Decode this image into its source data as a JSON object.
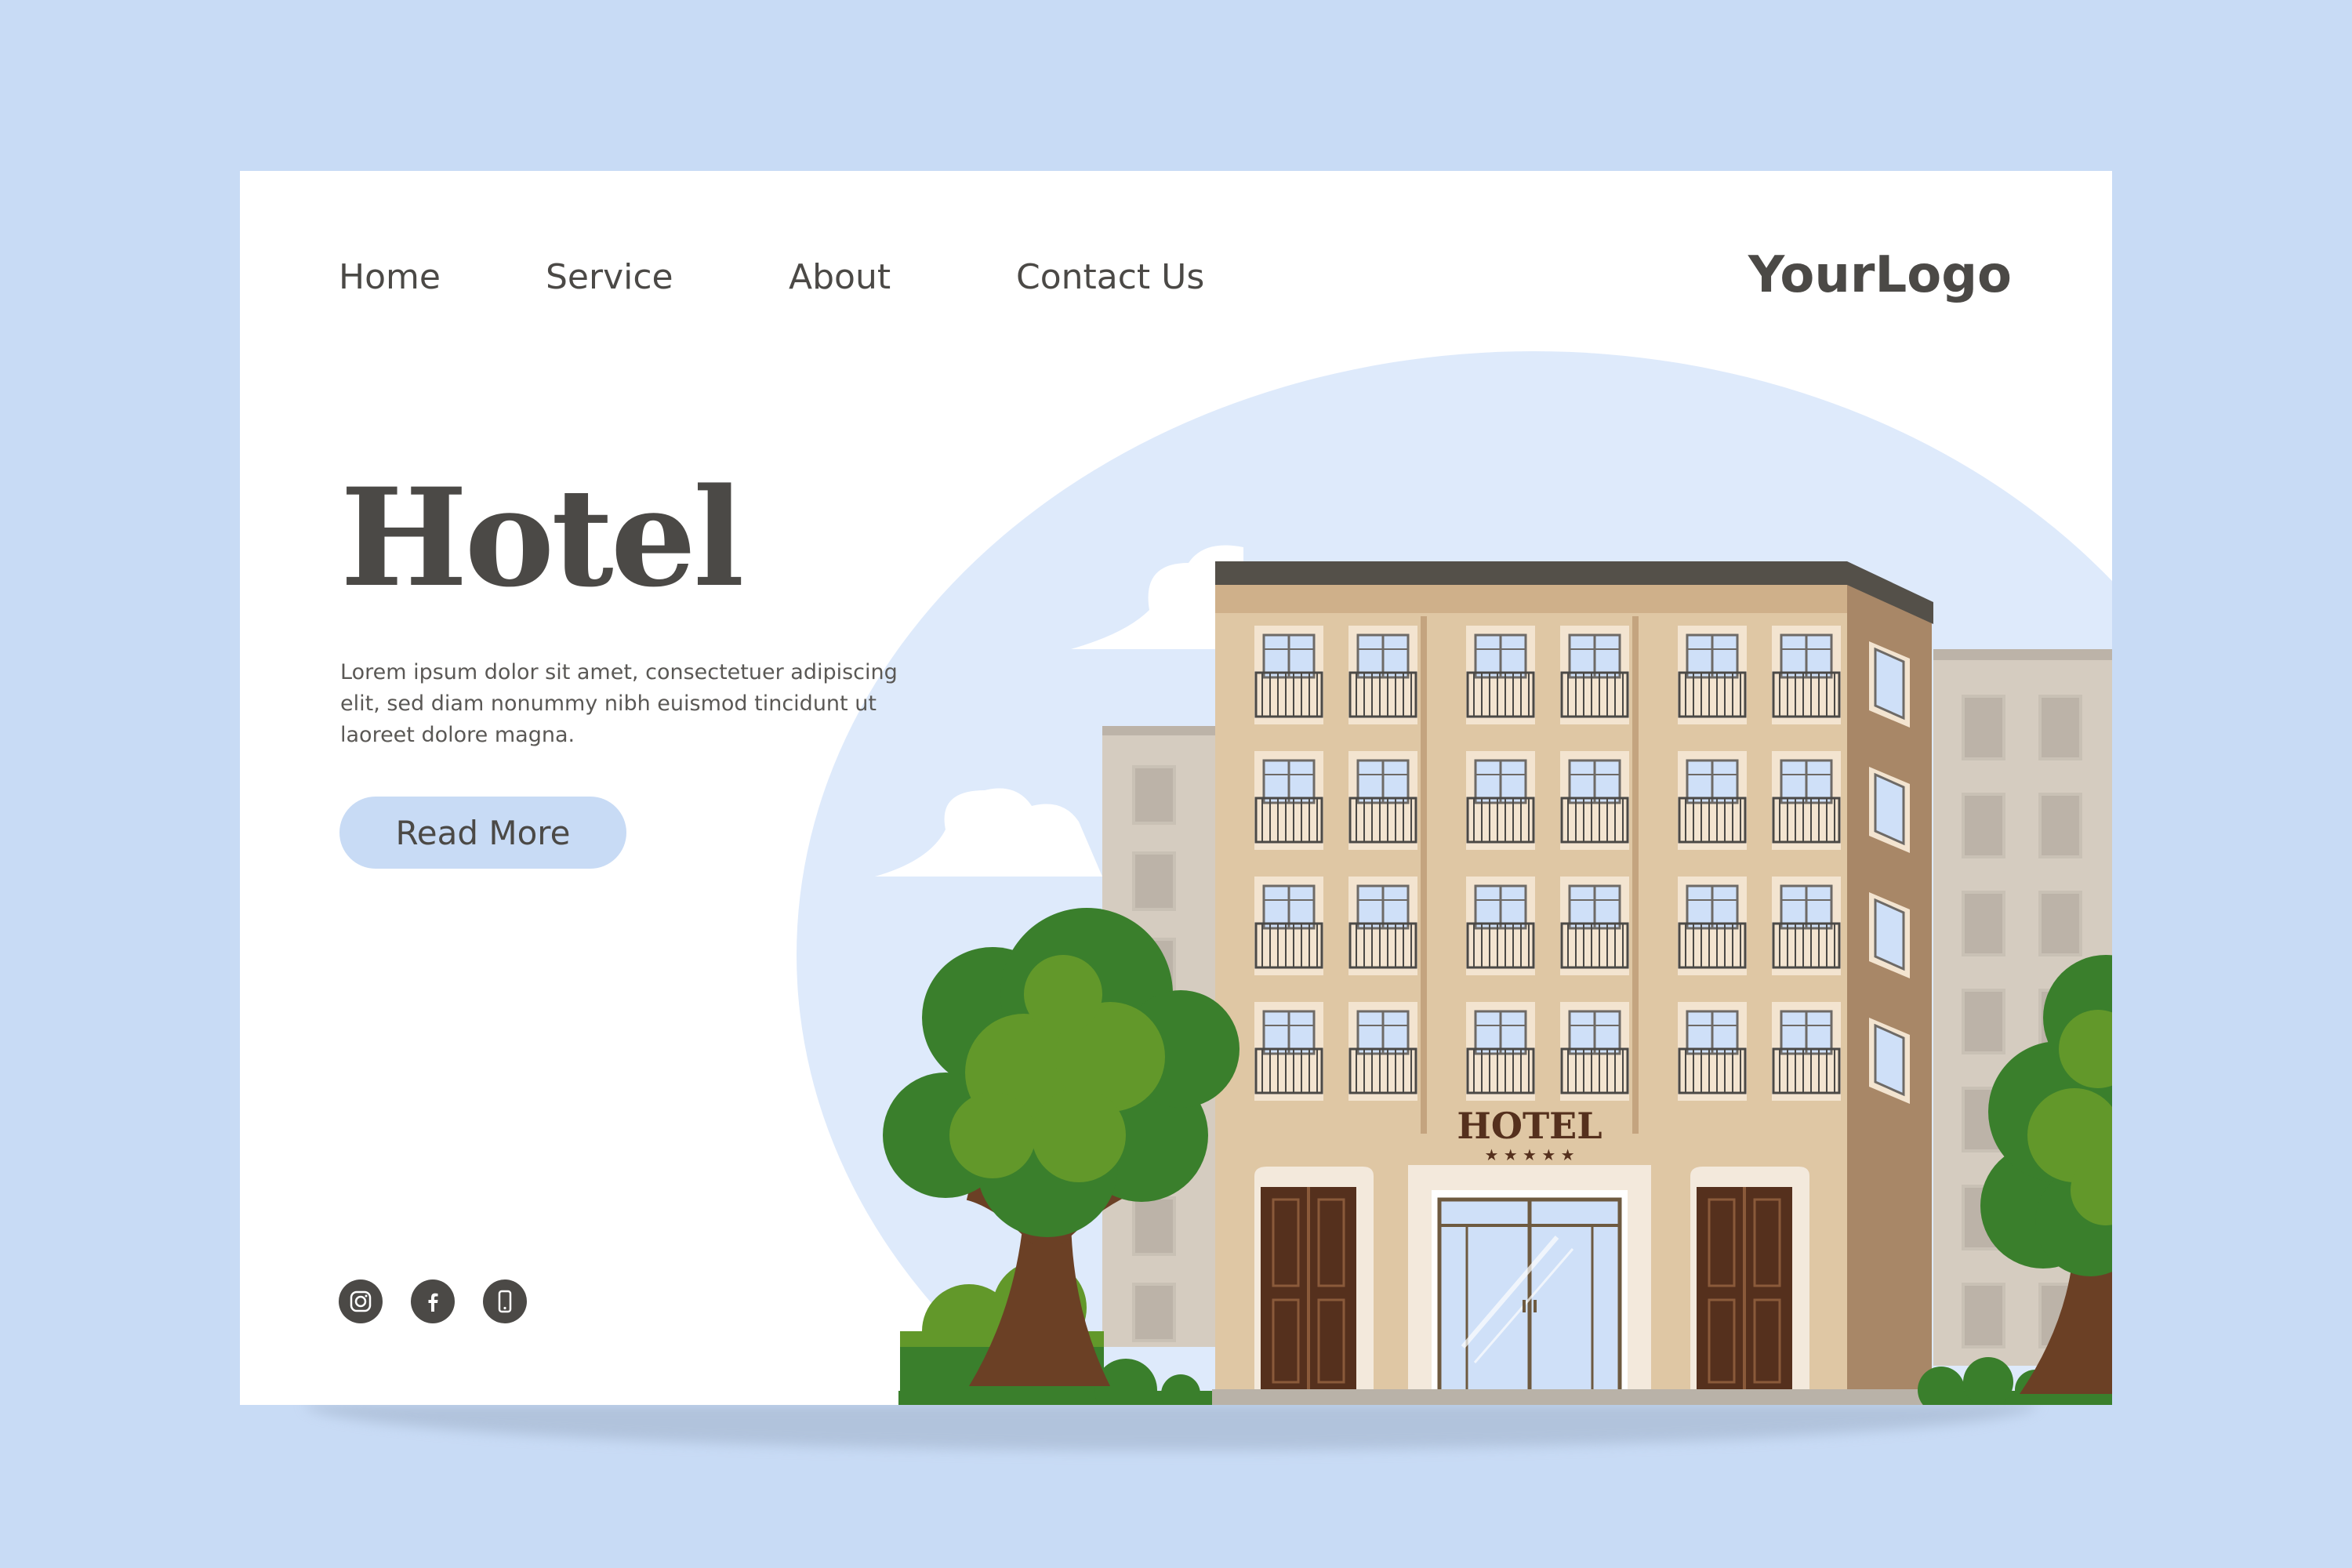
{
  "nav": {
    "items": [
      {
        "label": "Home"
      },
      {
        "label": "Service"
      },
      {
        "label": "About"
      },
      {
        "label": "Contact Us"
      }
    ],
    "logo": "YourLogo"
  },
  "hero": {
    "title": "Hotel",
    "text": "Lorem ipsum dolor sit amet, consectetuer adipiscing elit, sed diam nonummy nibh euismod tincidunt ut laoreet dolore magna.",
    "button_label": "Read More"
  },
  "illustration": {
    "sign_text": "HOTEL",
    "sign_stars": "★ ★ ★ ★ ★"
  },
  "social": {
    "icons": [
      "instagram-icon",
      "facebook-icon",
      "phone-icon"
    ]
  },
  "colors": {
    "background": "#c8dbf5",
    "card": "#ffffff",
    "text": "#4b4946",
    "sky": "#deeafb",
    "facade": "#dfc7a4",
    "facade_side": "#a88767",
    "roof": "#545049",
    "side_buildings": "#d5ccc0",
    "tree_dark": "#3a7f2c",
    "tree_light": "#62982a",
    "trunk": "#6b4025",
    "door": "#55301d"
  }
}
